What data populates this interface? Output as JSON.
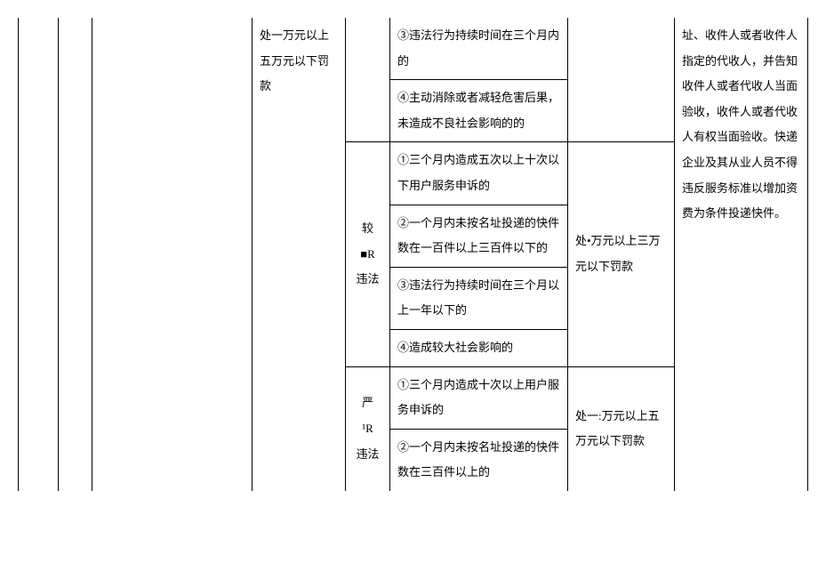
{
  "penalty_col": "处一万元以上五万元以下罚款",
  "group1": {
    "item3": "③违法行为持续时间在三个月内的",
    "item4": "④主动消除或者减轻危害后果，未造成不良社会影响的的"
  },
  "group2": {
    "label": "较\n■R\n违法",
    "item1": "①三个月内造成五次以上十次以下用户服务申诉的",
    "item2": "②一个月内未按名址投递的快件数在一百件以上三百件以下的",
    "item3": "③违法行为持续时间在三个月以上一年以下的",
    "item4": "④造成较大社会影响的",
    "penalty": "处•万元以上三万元以下罚款"
  },
  "group3": {
    "label": "严\n¹R\n违法",
    "item1": "①三个月内造成十次以上用户服务申诉的",
    "item2": "②一个月内未按名址投递的快件数在三百件以上的",
    "penalty": "处一:万元以上五万元以下罚款"
  },
  "right_col": "址、收件人或者收件人指定的代收人，并告知收件人或者代收人当面验收，收件人或者代收人有权当面验收。快递企业及其从业人员不得违反服务标准以增加资费为条件投递快件。"
}
